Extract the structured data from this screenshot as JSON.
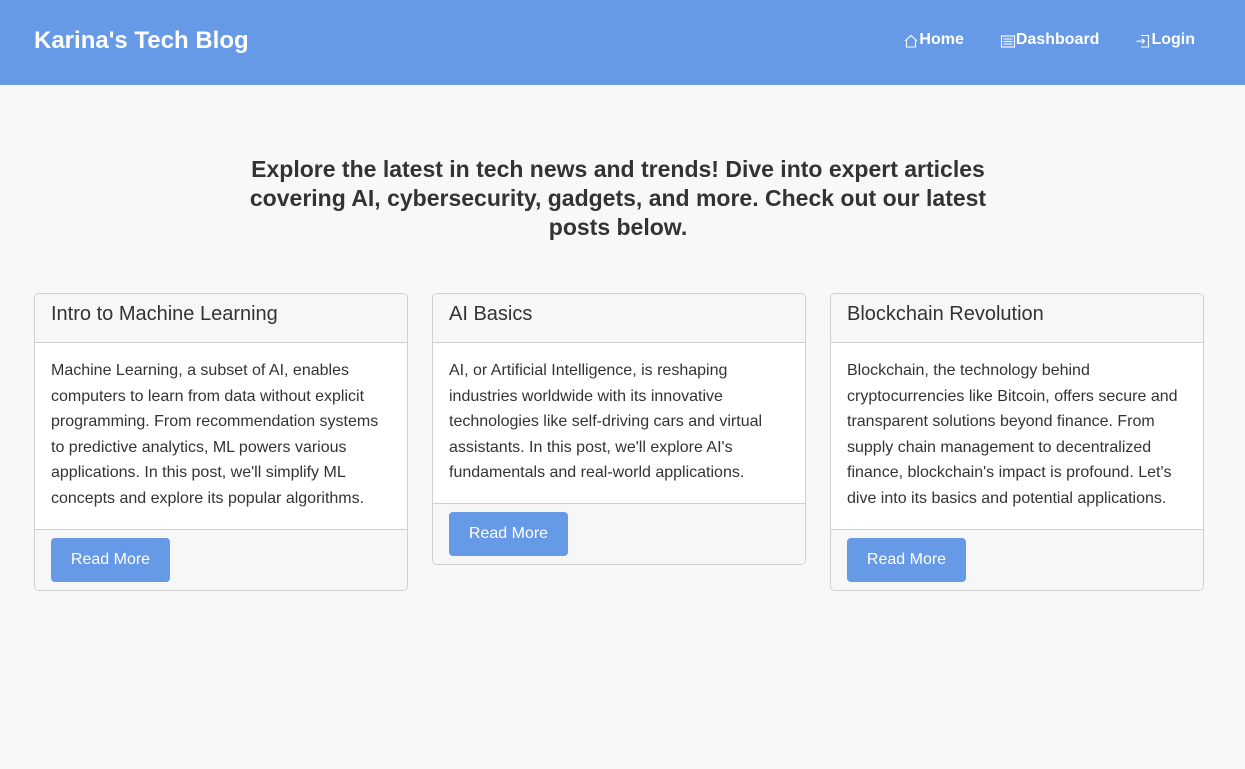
{
  "header": {
    "brand": "Karina's Tech Blog",
    "background": "#6699e6",
    "nav": [
      {
        "label": "Home",
        "icon": "home-icon"
      },
      {
        "label": "Dashboard",
        "icon": "dashboard-icon"
      },
      {
        "label": "Login",
        "icon": "login-icon"
      }
    ]
  },
  "intro": {
    "text": "Explore the latest in tech news and trends! Dive into expert articles covering AI, cybersecurity, gadgets, and more. Check out our latest posts below."
  },
  "posts": [
    {
      "title": "Intro to Machine Learning",
      "body": "Machine Learning, a subset of AI, enables computers to learn from data without explicit programming. From recommendation systems to predictive analytics, ML powers various applications. In this post, we'll simplify ML concepts and explore its popular algorithms.",
      "button": "Read More"
    },
    {
      "title": "AI Basics",
      "body": "AI, or Artificial Intelligence, is reshaping industries worldwide with its innovative technologies like self-driving cars and virtual assistants. In this post, we'll explore AI's fundamentals and real-world applications.",
      "button": "Read More"
    },
    {
      "title": "Blockchain Revolution",
      "body": "Blockchain, the technology behind cryptocurrencies like Bitcoin, offers secure and transparent solutions beyond finance. From supply chain management to decentralized finance, blockchain's impact is profound. Let's dive into its basics and potential applications.",
      "button": "Read More"
    }
  ]
}
